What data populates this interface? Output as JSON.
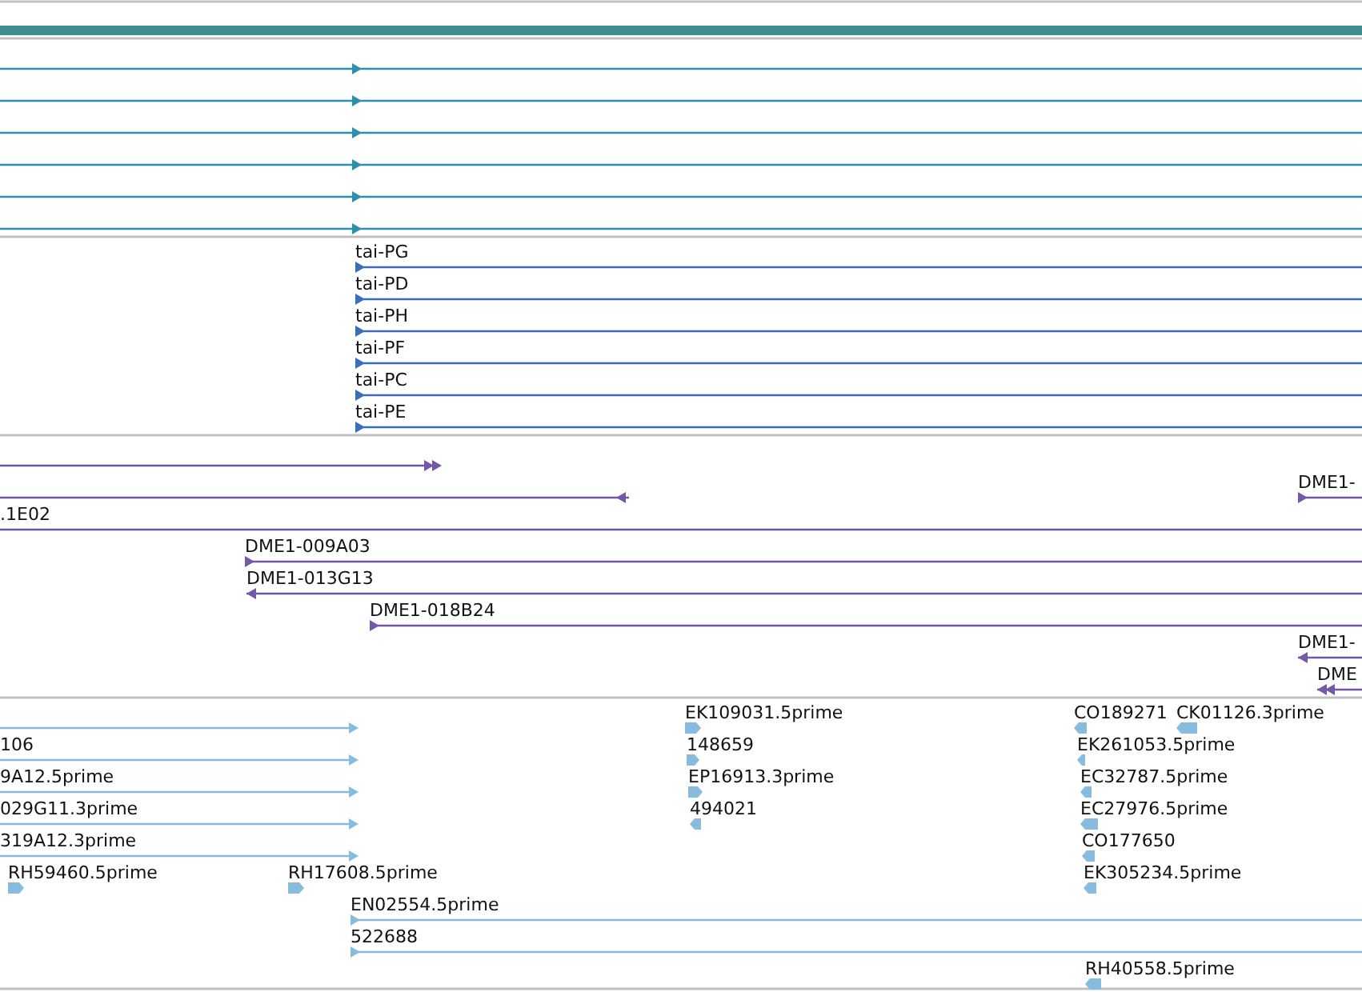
{
  "tracks": [
    {
      "kind": "bar",
      "color": "#3f8f90"
    },
    {
      "kind": "features",
      "color": "#2a8fb0",
      "features": [
        {
          "reverse": false
        },
        {
          "reverse": false
        },
        {
          "reverse": false
        },
        {
          "reverse": false
        },
        {
          "reverse": false
        },
        {
          "reverse": false
        }
      ]
    },
    {
      "kind": "features",
      "color": "#3a6cc0",
      "features": [
        {
          "label": "tai-PG",
          "reverse": false
        },
        {
          "label": "tai-PD",
          "reverse": false
        },
        {
          "label": "tai-PH",
          "reverse": false
        },
        {
          "label": "tai-PF",
          "reverse": false
        },
        {
          "label": "tai-PC",
          "reverse": false
        },
        {
          "label": "tai-PE",
          "reverse": false
        }
      ]
    },
    {
      "kind": "features",
      "color": "#7458a8",
      "features": [
        {
          "reverse": false
        },
        {
          "reverse": true
        },
        {
          "label": "DME1-",
          "reverse": false
        },
        {
          "label": ".1E02"
        },
        {
          "label": "DME1-009A03",
          "reverse": false
        },
        {
          "label": "DME1-013G13",
          "reverse": true
        },
        {
          "label": "DME1-018B24",
          "reverse": false
        },
        {
          "label": "DME1-",
          "reverse": true
        },
        {
          "label": "DME",
          "reverse": true
        }
      ]
    },
    {
      "kind": "features",
      "color": "#88bcdf",
      "features": [
        {
          "reverse": false
        },
        {
          "label": "106",
          "reverse": false
        },
        {
          "label": "9A12.5prime",
          "reverse": false
        },
        {
          "label": "029G11.3prime",
          "reverse": false
        },
        {
          "label": "319A12.3prime",
          "reverse": false
        },
        {
          "label": "RH59460.5prime",
          "reverse": false
        },
        {
          "label": "RH17608.5prime",
          "reverse": false
        },
        {
          "label": "EN02554.5prime",
          "reverse": false
        },
        {
          "label": "522688",
          "reverse": false
        },
        {
          "label": "EK109031.5prime",
          "reverse": false
        },
        {
          "label": "148659",
          "reverse": false
        },
        {
          "label": "EP16913.3prime",
          "reverse": false
        },
        {
          "label": "494021",
          "reverse": true
        },
        {
          "label": "CO189271",
          "reverse": true
        },
        {
          "label": "CK01126.3prime",
          "reverse": true
        },
        {
          "label": "EK261053.5prime",
          "reverse": true
        },
        {
          "label": "EC32787.5prime",
          "reverse": true
        },
        {
          "label": "EC27976.5prime",
          "reverse": true
        },
        {
          "label": "CO177650",
          "reverse": true
        },
        {
          "label": "EK305234.5prime",
          "reverse": true
        },
        {
          "label": "RH40558.5prime",
          "reverse": true
        }
      ]
    }
  ]
}
